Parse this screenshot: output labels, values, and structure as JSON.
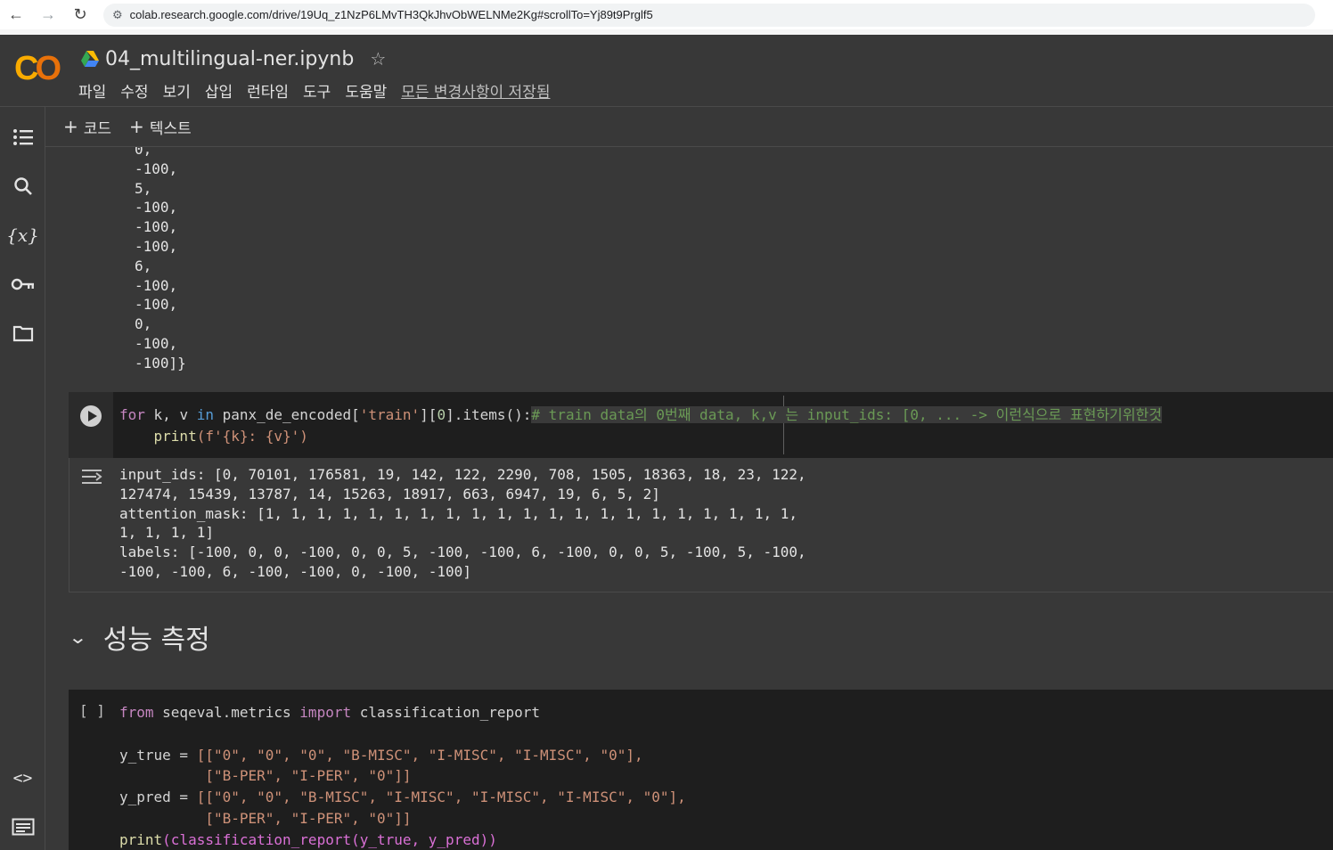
{
  "browser": {
    "url": "colab.research.google.com/drive/19Uq_z1NzP6LMvTH3QkJhvObWELNMe2Kg#scrollTo=Yj89t9Prglf5"
  },
  "header": {
    "logo": "CO",
    "doc_title": "04_multilingual-ner.ipynb",
    "menu": [
      "파일",
      "수정",
      "보기",
      "삽입",
      "런타임",
      "도구",
      "도움말"
    ],
    "saved_status": "모든 변경사항이 저장됨"
  },
  "toolbar": {
    "add_code": "코드",
    "add_text": "텍스트"
  },
  "left_rail": {
    "icons": [
      "toc-icon",
      "search-icon",
      "variables-icon",
      "key-icon",
      "folder-icon",
      "code-snippets-icon",
      "terminal-icon"
    ]
  },
  "prev_output": {
    "lines": [
      "0,",
      "-100,",
      "5,",
      "-100,",
      "-100,",
      "-100,",
      "6,",
      "-100,",
      "-100,",
      "0,",
      "-100,",
      "-100]}"
    ]
  },
  "cell1": {
    "line1_pre": "for",
    "line1_a": " k, v ",
    "line1_in": "in",
    "line1_b": " panx_de_encoded[",
    "line1_str": "'train'",
    "line1_c": "][",
    "line1_num": "0",
    "line1_d": "].items():",
    "line1_comment": "# train data의 0번째 data, k,v 는 input_ids: [0, ... -> 이런식으로 표현하기위한것",
    "line2_fn": "print",
    "line2_rest": "(f'{k}: {v}')"
  },
  "output1": {
    "lines": [
      "input_ids: [0, 70101, 176581, 19, 142, 122, 2290, 708, 1505, 18363, 18, 23, 122,",
      "127474, 15439, 13787, 14, 15263, 18917, 663, 6947, 19, 6, 5, 2]",
      "attention_mask: [1, 1, 1, 1, 1, 1, 1, 1, 1, 1, 1, 1, 1, 1, 1, 1, 1, 1, 1, 1, 1,",
      "1, 1, 1, 1]",
      "labels: [-100, 0, 0, -100, 0, 0, 5, -100, -100, 6, -100, 0, 0, 5, -100, 5, -100,",
      "-100, -100, 6, -100, -100, 0, -100, -100]"
    ]
  },
  "section": {
    "title": "성능 측정"
  },
  "cell2": {
    "bracket": "[ ]",
    "l1_from": "from",
    "l1_mod": " seqeval.metrics ",
    "l1_import": "import",
    "l1_name": " classification_report",
    "l3_a": "y_true = ",
    "l3_b": "[[\"0\", \"0\", \"0\", \"B-MISC\", \"I-MISC\", \"I-MISC\", \"0\"],",
    "l4": "          [\"B-PER\", \"I-PER\", \"0\"]]",
    "l5_a": "y_pred = ",
    "l5_b": "[[\"0\", \"0\", \"B-MISC\", \"I-MISC\", \"I-MISC\", \"I-MISC\", \"0\"],",
    "l6": "          [\"B-PER\", \"I-PER\", \"0\"]]",
    "l7_fn": "print",
    "l7_rest": "(classification_report(y_true, y_pred))"
  }
}
